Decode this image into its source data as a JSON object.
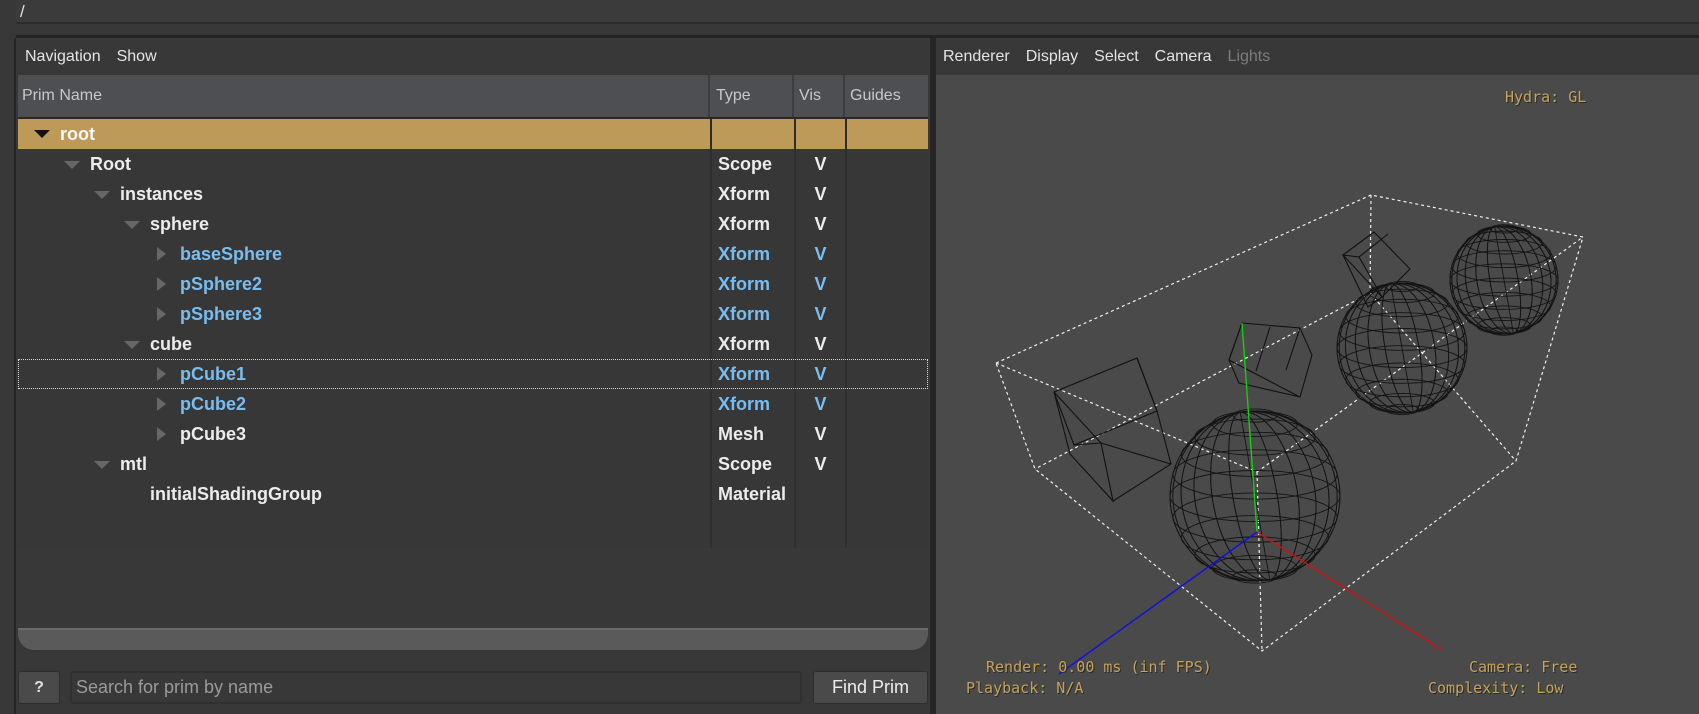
{
  "path_bar": {
    "path": "/"
  },
  "browser": {
    "menu": [
      "Navigation",
      "Show"
    ],
    "columns": {
      "name": "Prim Name",
      "type": "Type",
      "vis": "Vis",
      "guides": "Guides"
    },
    "rows": [
      {
        "name": "root",
        "type": "",
        "vis": "",
        "depth": 0,
        "expander": "expanded",
        "selected": true,
        "instance": false,
        "focused": false
      },
      {
        "name": "Root",
        "type": "Scope",
        "vis": "V",
        "depth": 1,
        "expander": "expanded",
        "selected": false,
        "instance": false,
        "focused": false
      },
      {
        "name": "instances",
        "type": "Xform",
        "vis": "V",
        "depth": 2,
        "expander": "expanded",
        "selected": false,
        "instance": false,
        "focused": false
      },
      {
        "name": "sphere",
        "type": "Xform",
        "vis": "V",
        "depth": 3,
        "expander": "expanded",
        "selected": false,
        "instance": false,
        "focused": false
      },
      {
        "name": "baseSphere",
        "type": "Xform",
        "vis": "V",
        "depth": 4,
        "expander": "collapsed",
        "selected": false,
        "instance": true,
        "focused": false
      },
      {
        "name": "pSphere2",
        "type": "Xform",
        "vis": "V",
        "depth": 4,
        "expander": "collapsed",
        "selected": false,
        "instance": true,
        "focused": false
      },
      {
        "name": "pSphere3",
        "type": "Xform",
        "vis": "V",
        "depth": 4,
        "expander": "collapsed",
        "selected": false,
        "instance": true,
        "focused": false
      },
      {
        "name": "cube",
        "type": "Xform",
        "vis": "V",
        "depth": 3,
        "expander": "expanded",
        "selected": false,
        "instance": false,
        "focused": false
      },
      {
        "name": "pCube1",
        "type": "Xform",
        "vis": "V",
        "depth": 4,
        "expander": "collapsed",
        "selected": false,
        "instance": true,
        "focused": true
      },
      {
        "name": "pCube2",
        "type": "Xform",
        "vis": "V",
        "depth": 4,
        "expander": "collapsed",
        "selected": false,
        "instance": true,
        "focused": false
      },
      {
        "name": "pCube3",
        "type": "Mesh",
        "vis": "V",
        "depth": 4,
        "expander": "collapsed",
        "selected": false,
        "instance": false,
        "focused": false
      },
      {
        "name": "mtl",
        "type": "Scope",
        "vis": "V",
        "depth": 2,
        "expander": "expanded",
        "selected": false,
        "instance": false,
        "focused": false
      },
      {
        "name": "initialShadingGroup",
        "type": "Material",
        "vis": "",
        "depth": 3,
        "expander": "none",
        "selected": false,
        "instance": false,
        "focused": false
      }
    ],
    "help_button": "?",
    "search_placeholder": "Search for prim by name",
    "search_value": "",
    "find_button": "Find Prim"
  },
  "viewer": {
    "menu": [
      {
        "label": "Renderer",
        "enabled": true
      },
      {
        "label": "Display",
        "enabled": true
      },
      {
        "label": "Select",
        "enabled": true
      },
      {
        "label": "Camera",
        "enabled": true
      },
      {
        "label": "Lights",
        "enabled": false
      }
    ],
    "hud": {
      "renderer": "Hydra: GL",
      "render_stats": "Render: 0.00 ms (inf FPS)",
      "playback": "Playback: N/A",
      "camera": "Camera: Free",
      "complexity": "Complexity: Low"
    },
    "colors": {
      "hud_text": "#c4a15c",
      "selection": "#bd9a58",
      "instance_text": "#79bdf0",
      "axis_x": "#d01010",
      "axis_y": "#10d010",
      "axis_z": "#1010e0"
    }
  }
}
